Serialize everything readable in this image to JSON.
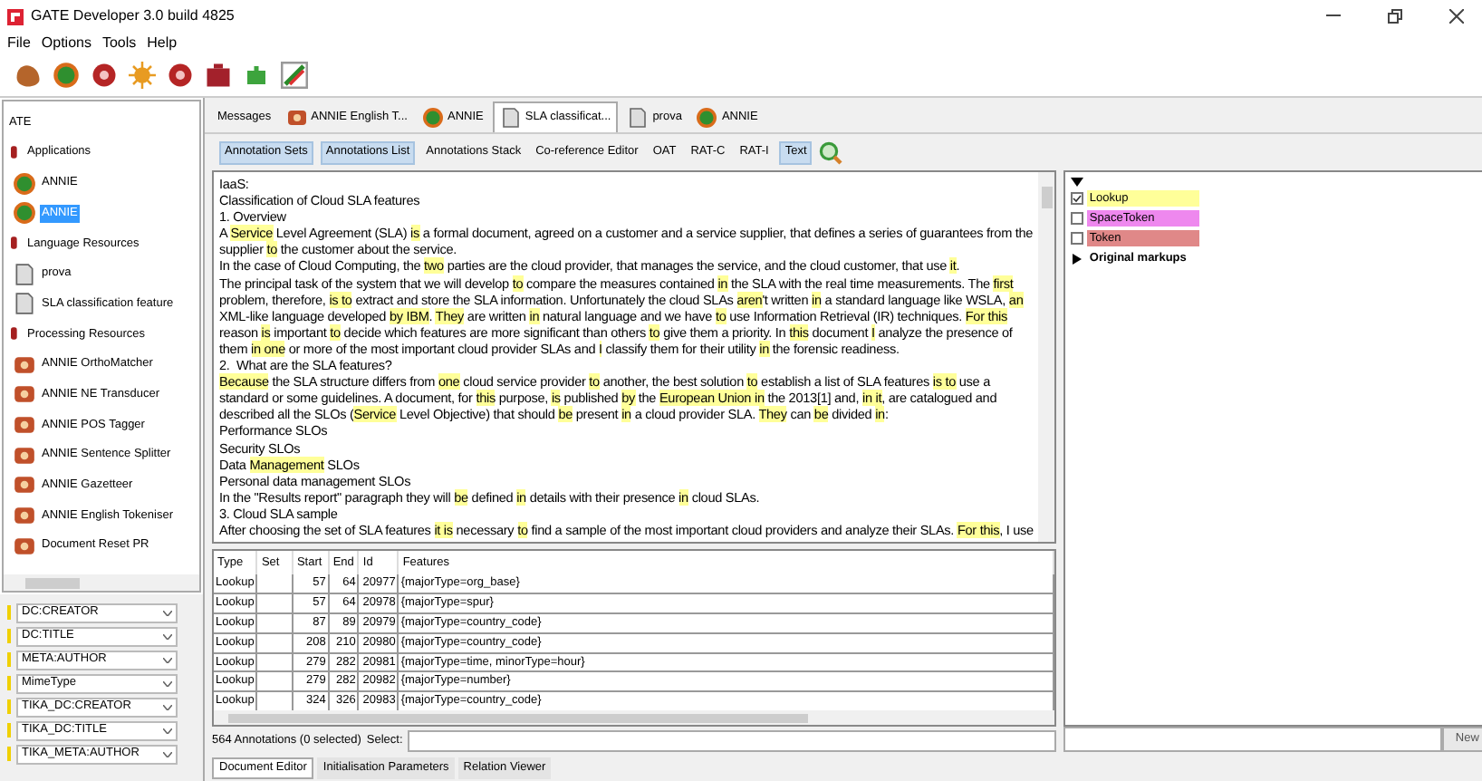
{
  "window": {
    "title": "GATE Developer 3.0 build 4825"
  },
  "menu": [
    "File",
    "Options",
    "Tools",
    "Help"
  ],
  "toolbar": [
    {
      "kind": "blob"
    },
    {
      "kind": "ring"
    },
    {
      "kind": "gear"
    },
    {
      "kind": "sun"
    },
    {
      "kind": "gear"
    },
    {
      "kind": "case"
    },
    {
      "kind": "puzzle"
    },
    {
      "kind": "pencil"
    }
  ],
  "resource_tree": {
    "root": "ATE",
    "children": [
      {
        "label": "Applications",
        "kind": "group",
        "selected": false,
        "children": [
          {
            "label": "ANNIE",
            "kind": "app",
            "selected": false
          },
          {
            "label": "ANNIE",
            "kind": "app",
            "selected": true
          }
        ]
      },
      {
        "label": "Language Resources",
        "kind": "group",
        "selected": false,
        "children": [
          {
            "label": "prova",
            "kind": "doc",
            "selected": false
          },
          {
            "label": "SLA classification feature",
            "kind": "doc",
            "selected": false
          }
        ]
      },
      {
        "label": "Processing Resources",
        "kind": "group",
        "selected": false,
        "children": [
          {
            "label": "ANNIE OrthoMatcher",
            "kind": "pr",
            "selected": false
          },
          {
            "label": "ANNIE NE Transducer",
            "kind": "pr",
            "selected": false
          },
          {
            "label": "ANNIE POS Tagger",
            "kind": "pr",
            "selected": false
          },
          {
            "label": "ANNIE Sentence Splitter",
            "kind": "pr",
            "selected": false
          },
          {
            "label": "ANNIE Gazetteer",
            "kind": "pr",
            "selected": false
          },
          {
            "label": "ANNIE English Tokeniser",
            "kind": "pr",
            "selected": false
          },
          {
            "label": "Document Reset PR",
            "kind": "pr",
            "selected": false
          }
        ]
      }
    ]
  },
  "features": [
    "DC:CREATOR",
    "DC:TITLE",
    "META:AUTHOR",
    "MimeType",
    "TIKA_DC:CREATOR",
    "TIKA_DC:TITLE",
    "TIKA_META:AUTHOR"
  ],
  "tabs": [
    {
      "label": "Messages",
      "kind": "plain",
      "selected": false
    },
    {
      "label": "ANNIE English T...",
      "kind": "pr",
      "selected": false
    },
    {
      "label": "ANNIE",
      "kind": "app",
      "selected": false
    },
    {
      "label": "SLA classificat...",
      "kind": "doc",
      "selected": true
    },
    {
      "label": "prova",
      "kind": "doc",
      "selected": false
    },
    {
      "label": "ANNIE",
      "kind": "app",
      "selected": false
    }
  ],
  "view_buttons": [
    {
      "label": "Annotation Sets",
      "on": true
    },
    {
      "label": "Annotations List",
      "on": true
    },
    {
      "label": "Annotations Stack",
      "on": false
    },
    {
      "label": "Co-reference Editor",
      "on": false
    },
    {
      "label": "OAT",
      "on": false
    },
    {
      "label": "RAT-C",
      "on": false
    },
    {
      "label": "RAT-I",
      "on": false
    },
    {
      "label": "Text",
      "on": true
    }
  ],
  "document": {
    "lines": [
      [
        {
          "text": "IaaS:",
          "highlighted": false
        }
      ],
      [
        {
          "text": "Classification of Cloud SLA features",
          "highlighted": false
        }
      ],
      [
        {
          "text": "1. Overview",
          "highlighted": false
        }
      ],
      [
        {
          "text": "A ",
          "highlighted": false
        },
        {
          "text": "Service",
          "highlighted": true
        },
        {
          "text": " Level Agreement (SLA) ",
          "highlighted": false
        },
        {
          "text": "is",
          "highlighted": true
        },
        {
          "text": " a formal document, agreed on a customer and a service supplier, that defines a series of guarantees from the",
          "highlighted": false
        }
      ],
      [
        {
          "text": "supplier ",
          "highlighted": false
        },
        {
          "text": "to",
          "highlighted": true
        },
        {
          "text": " the customer about the service.",
          "highlighted": false
        }
      ],
      [
        {
          "text": "In the case of Cloud Computing, the ",
          "highlighted": false
        },
        {
          "text": "two",
          "highlighted": true
        },
        {
          "text": " parties are the cloud provider, that manages the service, and the cloud customer, that use ",
          "highlighted": false
        },
        {
          "text": "it",
          "highlighted": true
        },
        {
          "text": ".",
          "highlighted": false
        }
      ],
      [
        {
          "text": "The principal task of the system that we will develop ",
          "highlighted": false
        },
        {
          "text": "to",
          "highlighted": true
        },
        {
          "text": " compare the measures contained ",
          "highlighted": false
        },
        {
          "text": "in",
          "highlighted": true
        },
        {
          "text": " the SLA with the real time measurements. The ",
          "highlighted": false
        },
        {
          "text": "first",
          "highlighted": true
        }
      ],
      [
        {
          "text": "problem, therefore, ",
          "highlighted": false
        },
        {
          "text": "is to",
          "highlighted": true
        },
        {
          "text": " extract and store the SLA information. Unfortunately the cloud SLAs ",
          "highlighted": false
        },
        {
          "text": "aren",
          "highlighted": true
        },
        {
          "text": "'t written ",
          "highlighted": false
        },
        {
          "text": "in",
          "highlighted": true
        },
        {
          "text": " a standard language like WSLA, ",
          "highlighted": false
        },
        {
          "text": "an",
          "highlighted": true
        }
      ],
      [
        {
          "text": "XML-like language developed ",
          "highlighted": false
        },
        {
          "text": "by IBM",
          "highlighted": true
        },
        {
          "text": ". ",
          "highlighted": false
        },
        {
          "text": "They",
          "highlighted": true
        },
        {
          "text": " are written ",
          "highlighted": false
        },
        {
          "text": "in",
          "highlighted": true
        },
        {
          "text": " natural language and we have ",
          "highlighted": false
        },
        {
          "text": "to",
          "highlighted": true
        },
        {
          "text": " use Information Retrieval (IR) techniques. ",
          "highlighted": false
        },
        {
          "text": "For this",
          "highlighted": true
        }
      ],
      [
        {
          "text": "reason ",
          "highlighted": false
        },
        {
          "text": "is",
          "highlighted": true
        },
        {
          "text": " important ",
          "highlighted": false
        },
        {
          "text": "to",
          "highlighted": true
        },
        {
          "text": " decide which features are more significant than others ",
          "highlighted": false
        },
        {
          "text": "to",
          "highlighted": true
        },
        {
          "text": " give them a priority. In ",
          "highlighted": false
        },
        {
          "text": "this",
          "highlighted": true
        },
        {
          "text": " document ",
          "highlighted": false
        },
        {
          "text": "I",
          "highlighted": true
        },
        {
          "text": " analyze the presence of",
          "highlighted": false
        }
      ],
      [
        {
          "text": "them ",
          "highlighted": false
        },
        {
          "text": "in one",
          "highlighted": true
        },
        {
          "text": " or more of the most important cloud provider SLAs and ",
          "highlighted": false
        },
        {
          "text": "I",
          "highlighted": true
        },
        {
          "text": " classify them for their utility ",
          "highlighted": false
        },
        {
          "text": "in",
          "highlighted": true
        },
        {
          "text": " the forensic readiness.",
          "highlighted": false
        }
      ],
      [
        {
          "text": "2.  What are the SLA features?",
          "highlighted": false
        }
      ],
      [
        {
          "text": "Because",
          "highlighted": true
        },
        {
          "text": " the SLA structure differs from ",
          "highlighted": false
        },
        {
          "text": "one",
          "highlighted": true
        },
        {
          "text": " cloud service provider ",
          "highlighted": false
        },
        {
          "text": "to",
          "highlighted": true
        },
        {
          "text": " another, the best solution ",
          "highlighted": false
        },
        {
          "text": "to",
          "highlighted": true
        },
        {
          "text": " establish a list of SLA features ",
          "highlighted": false
        },
        {
          "text": "is to",
          "highlighted": true
        },
        {
          "text": " use a",
          "highlighted": false
        }
      ],
      [
        {
          "text": "standard or some guidelines. A document, for ",
          "highlighted": false
        },
        {
          "text": "this",
          "highlighted": true
        },
        {
          "text": " purpose, ",
          "highlighted": false
        },
        {
          "text": "is",
          "highlighted": true
        },
        {
          "text": " published ",
          "highlighted": false
        },
        {
          "text": "by",
          "highlighted": true
        },
        {
          "text": " the ",
          "highlighted": false
        },
        {
          "text": "European Union in",
          "highlighted": true
        },
        {
          "text": " the 2013[1] and, ",
          "highlighted": false
        },
        {
          "text": "in it",
          "highlighted": true
        },
        {
          "text": ", are catalogued and",
          "highlighted": false
        }
      ],
      [
        {
          "text": "described all the SLOs (",
          "highlighted": false
        },
        {
          "text": "Service",
          "highlighted": true
        },
        {
          "text": " Level Objective) that should ",
          "highlighted": false
        },
        {
          "text": "be",
          "highlighted": true
        },
        {
          "text": " present ",
          "highlighted": false
        },
        {
          "text": "in",
          "highlighted": true
        },
        {
          "text": " a cloud provider SLA. ",
          "highlighted": false
        },
        {
          "text": "They",
          "highlighted": true
        },
        {
          "text": " can ",
          "highlighted": false
        },
        {
          "text": "be",
          "highlighted": true
        },
        {
          "text": " divided ",
          "highlighted": false
        },
        {
          "text": "in",
          "highlighted": true
        },
        {
          "text": ":",
          "highlighted": false
        }
      ],
      [
        {
          "text": "Performance SLOs",
          "highlighted": false
        }
      ],
      [
        {
          "text": "Security SLOs",
          "highlighted": false
        }
      ],
      [
        {
          "text": "Data ",
          "highlighted": false
        },
        {
          "text": "Management",
          "highlighted": true
        },
        {
          "text": " SLOs",
          "highlighted": false
        }
      ],
      [
        {
          "text": "Personal data management SLOs",
          "highlighted": false
        }
      ],
      [
        {
          "text": "In the \"Results report\" paragraph they will ",
          "highlighted": false
        },
        {
          "text": "be",
          "highlighted": true
        },
        {
          "text": " defined ",
          "highlighted": false
        },
        {
          "text": "in",
          "highlighted": true
        },
        {
          "text": " details with their presence ",
          "highlighted": false
        },
        {
          "text": "in",
          "highlighted": true
        },
        {
          "text": " cloud SLAs.",
          "highlighted": false
        }
      ],
      [
        {
          "text": "3. Cloud SLA sample",
          "highlighted": false
        }
      ],
      [
        {
          "text": "After choosing the set of SLA features ",
          "highlighted": false
        },
        {
          "text": "it is",
          "highlighted": true
        },
        {
          "text": " necessary ",
          "highlighted": false
        },
        {
          "text": "to",
          "highlighted": true
        },
        {
          "text": " find a sample of the most important cloud providers and analyze their SLAs. ",
          "highlighted": false
        },
        {
          "text": "For this",
          "highlighted": true
        },
        {
          "text": ", I use",
          "highlighted": false
        }
      ]
    ]
  },
  "annotation_sets": {
    "items": [
      {
        "label": "Lookup",
        "checked": true,
        "color": "#ffff99"
      },
      {
        "label": "SpaceToken",
        "checked": false,
        "color": "#ee88ee"
      },
      {
        "label": "Token",
        "checked": false,
        "color": "#e08888"
      }
    ],
    "groups": [
      {
        "label": "Original markups",
        "expanded": false
      }
    ],
    "new_button": "New"
  },
  "annotations_table": {
    "columns": [
      "Type",
      "Set",
      "Start",
      "End",
      "Id",
      "Features"
    ],
    "rows": [
      {
        "type": "Lookup",
        "start": "57",
        "end": "64",
        "id": "20977",
        "features": "{majorType=org_base}"
      },
      {
        "type": "Lookup",
        "start": "57",
        "end": "64",
        "id": "20978",
        "features": "{majorType=spur}"
      },
      {
        "type": "Lookup",
        "start": "87",
        "end": "89",
        "id": "20979",
        "features": "{majorType=country_code}"
      },
      {
        "type": "Lookup",
        "start": "208",
        "end": "210",
        "id": "20980",
        "features": "{majorType=country_code}"
      },
      {
        "type": "Lookup",
        "start": "279",
        "end": "282",
        "id": "20981",
        "features": "{majorType=time, minorType=hour}"
      },
      {
        "type": "Lookup",
        "start": "279",
        "end": "282",
        "id": "20982",
        "features": "{majorType=number}"
      },
      {
        "type": "Lookup",
        "start": "324",
        "end": "326",
        "id": "20983",
        "features": "{majorType=country_code}"
      }
    ]
  },
  "status": {
    "count": "564 Annotations (0 selected)",
    "select_label": "Select:"
  },
  "bottom_tabs": [
    {
      "label": "Document Editor",
      "selected": true
    },
    {
      "label": "Initialisation Parameters",
      "selected": false
    },
    {
      "label": "Relation Viewer",
      "selected": false
    }
  ]
}
